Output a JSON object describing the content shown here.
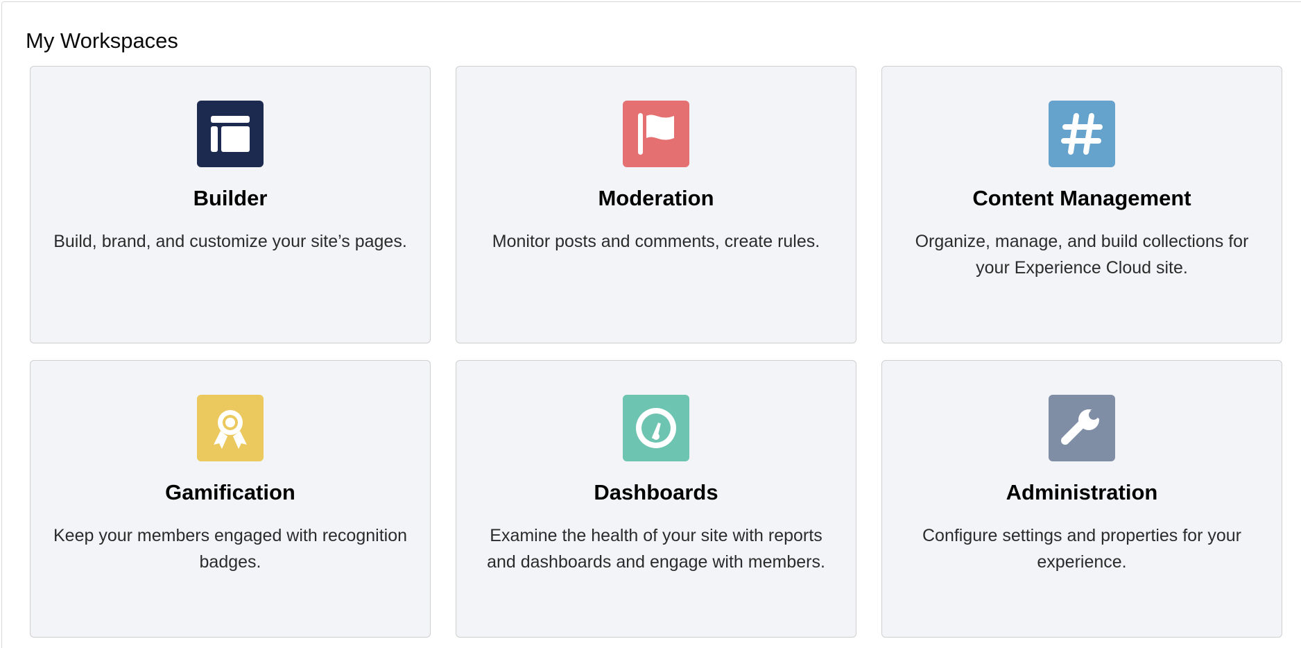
{
  "page": {
    "title": "My Workspaces"
  },
  "workspaces": [
    {
      "title": "Builder",
      "description": "Build, brand, and customize your site’s pages.",
      "icon": "builder-layout-icon",
      "color": "#1b2a4e"
    },
    {
      "title": "Moderation",
      "description": "Monitor posts and comments, create rules.",
      "icon": "flag-icon",
      "color": "#e57071"
    },
    {
      "title": "Content Management",
      "description": "Organize, manage, and build collections for your Experience Cloud site.",
      "icon": "hashtag-icon",
      "color": "#65a2cc"
    },
    {
      "title": "Gamification",
      "description": "Keep your members engaged with recognition badges.",
      "icon": "ribbon-award-icon",
      "color": "#ebc95e"
    },
    {
      "title": "Dashboards",
      "description": "Examine the health of your site with reports and dashboards and engage with members.",
      "icon": "gauge-icon",
      "color": "#6cc4b1"
    },
    {
      "title": "Administration",
      "description": "Configure settings and properties for your experience.",
      "icon": "wrench-icon",
      "color": "#7f8ea5"
    }
  ]
}
